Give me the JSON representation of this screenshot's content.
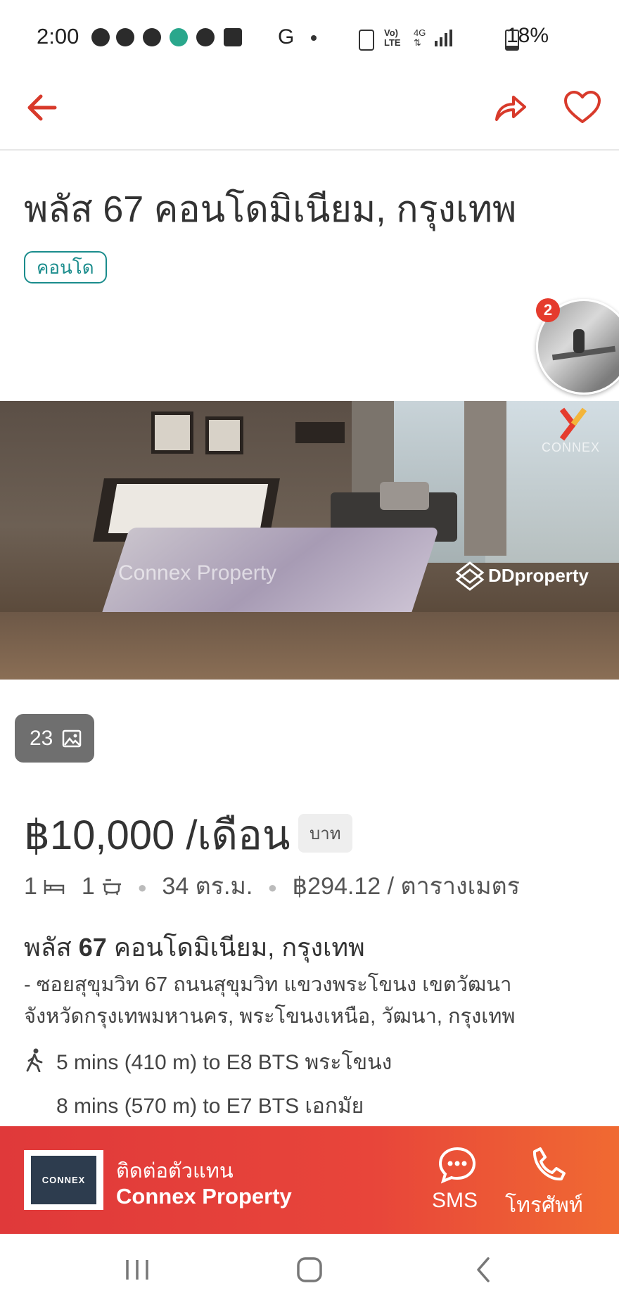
{
  "status_bar": {
    "time": "2:00",
    "battery": "18%"
  },
  "listing": {
    "title": "พลัส 67 คอนโดมิเนียม, กรุงเทพ",
    "type_tag": "คอนโด",
    "floating_badge_count": "2",
    "photo_watermarks": [
      "Connex Property",
      "DDproperty",
      "CONNEX"
    ],
    "photo_count": "23",
    "price": "฿10,000 /เดือน",
    "currency_label": "บาท",
    "bedrooms": "1",
    "bathrooms": "1",
    "area": "34 ตร.ม.",
    "price_per_sqm": "฿294.12 / ตารางเมตร",
    "project_name_prefix": "พลัส ",
    "project_name_bold": "67",
    "project_name_suffix": " คอนโดมิเนียม, กรุงเทพ",
    "address_line1": "- ซอยสุขุมวิท 67 ถนนสุขุมวิท แขวงพระโขนง เขตวัฒนา",
    "address_line2": "จังหวัดกรุงเทพมหานคร, พระโขนงเหนือ, วัฒนา, กรุงเทพ",
    "transit": [
      "5 mins (410 m) to E8 BTS พระโขนง",
      "8 mins (570 m) to E7 BTS เอกมัย"
    ]
  },
  "contact_bar": {
    "agent_prompt": "ติดต่อตัวแทน",
    "agent_name": "Connex Property",
    "agent_logo_text": "CONNEX",
    "sms_label": "SMS",
    "call_label": "โทรศัพท์"
  },
  "colors": {
    "accent": "#e0393a",
    "teal": "#1a8c8c"
  }
}
